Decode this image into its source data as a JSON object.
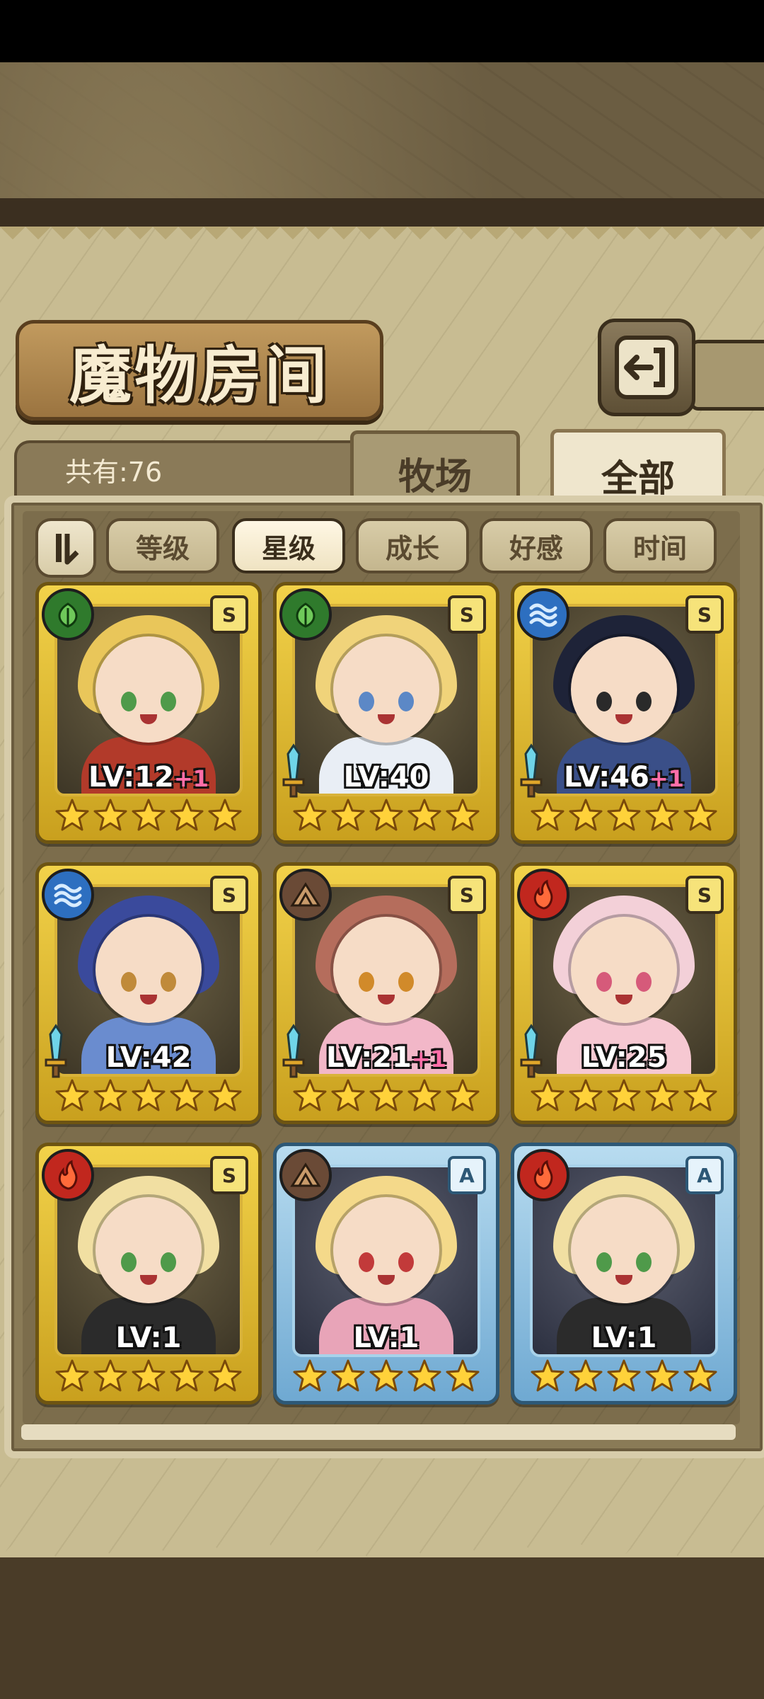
{
  "screen": {
    "title": "魔物房间",
    "count_text": "共有:76",
    "tabs": [
      {
        "label": "牧场",
        "active": false
      },
      {
        "label": "全部",
        "active": true
      }
    ],
    "sort_buttons": [
      {
        "label": "等级",
        "active": false
      },
      {
        "label": "星级",
        "active": true
      },
      {
        "label": "成长",
        "active": false
      },
      {
        "label": "好感",
        "active": false
      },
      {
        "label": "时间",
        "active": false
      }
    ]
  },
  "monsters": [
    {
      "element": "leaf",
      "rank": "S",
      "frame": "gold",
      "level": "LV:12",
      "bonus": "+1",
      "stars": 5,
      "hair": "#e9c65a",
      "eyes": "#4f9a4a",
      "outfit": "#b23a2a",
      "sword": false
    },
    {
      "element": "leaf",
      "rank": "S",
      "frame": "gold",
      "level": "LV:40",
      "bonus": "",
      "stars": 5,
      "hair": "#f0d37a",
      "eyes": "#5c88c6",
      "outfit": "#e9eef5",
      "sword": true
    },
    {
      "element": "water",
      "rank": "S",
      "frame": "gold",
      "level": "LV:46",
      "bonus": "+1",
      "stars": 5,
      "hair": "#1e2338",
      "eyes": "#2a2a2a",
      "outfit": "#3a4f88",
      "sword": true
    },
    {
      "element": "water",
      "rank": "S",
      "frame": "gold",
      "level": "LV:42",
      "bonus": "",
      "stars": 5,
      "hair": "#3a4a9c",
      "eyes": "#c08a3a",
      "outfit": "#6a8ccf",
      "sword": true
    },
    {
      "element": "earth",
      "rank": "S",
      "frame": "gold",
      "level": "LV:21",
      "bonus": "+1",
      "stars": 5,
      "hair": "#b56d5c",
      "eyes": "#d18a2a",
      "outfit": "#f2b7c8",
      "sword": true
    },
    {
      "element": "fire",
      "rank": "S",
      "frame": "gold",
      "level": "LV:25",
      "bonus": "",
      "stars": 5,
      "hair": "#f3d0d8",
      "eyes": "#d65a7a",
      "outfit": "#f6c8d2",
      "sword": true
    },
    {
      "element": "fire",
      "rank": "S",
      "frame": "gold",
      "level": "LV:1",
      "bonus": "",
      "stars": 5,
      "hair": "#f1dfa2",
      "eyes": "#4f9a4a",
      "outfit": "#2b2b2b",
      "sword": false
    },
    {
      "element": "earth",
      "rank": "A",
      "frame": "blue",
      "level": "LV:1",
      "bonus": "",
      "stars": 5,
      "hair": "#f4d98a",
      "eyes": "#c23a3a",
      "outfit": "#e8a4b8",
      "sword": false
    },
    {
      "element": "fire",
      "rank": "A",
      "frame": "blue",
      "level": "LV:1",
      "bonus": "",
      "stars": 5,
      "hair": "#f1dfa2",
      "eyes": "#4f9a4a",
      "outfit": "#2b2b2b",
      "sword": false
    }
  ],
  "element_colors": {
    "leaf": "#2f7a2c",
    "water": "#2d6fc0",
    "earth": "#6a4a36",
    "fire": "#c1271e"
  }
}
